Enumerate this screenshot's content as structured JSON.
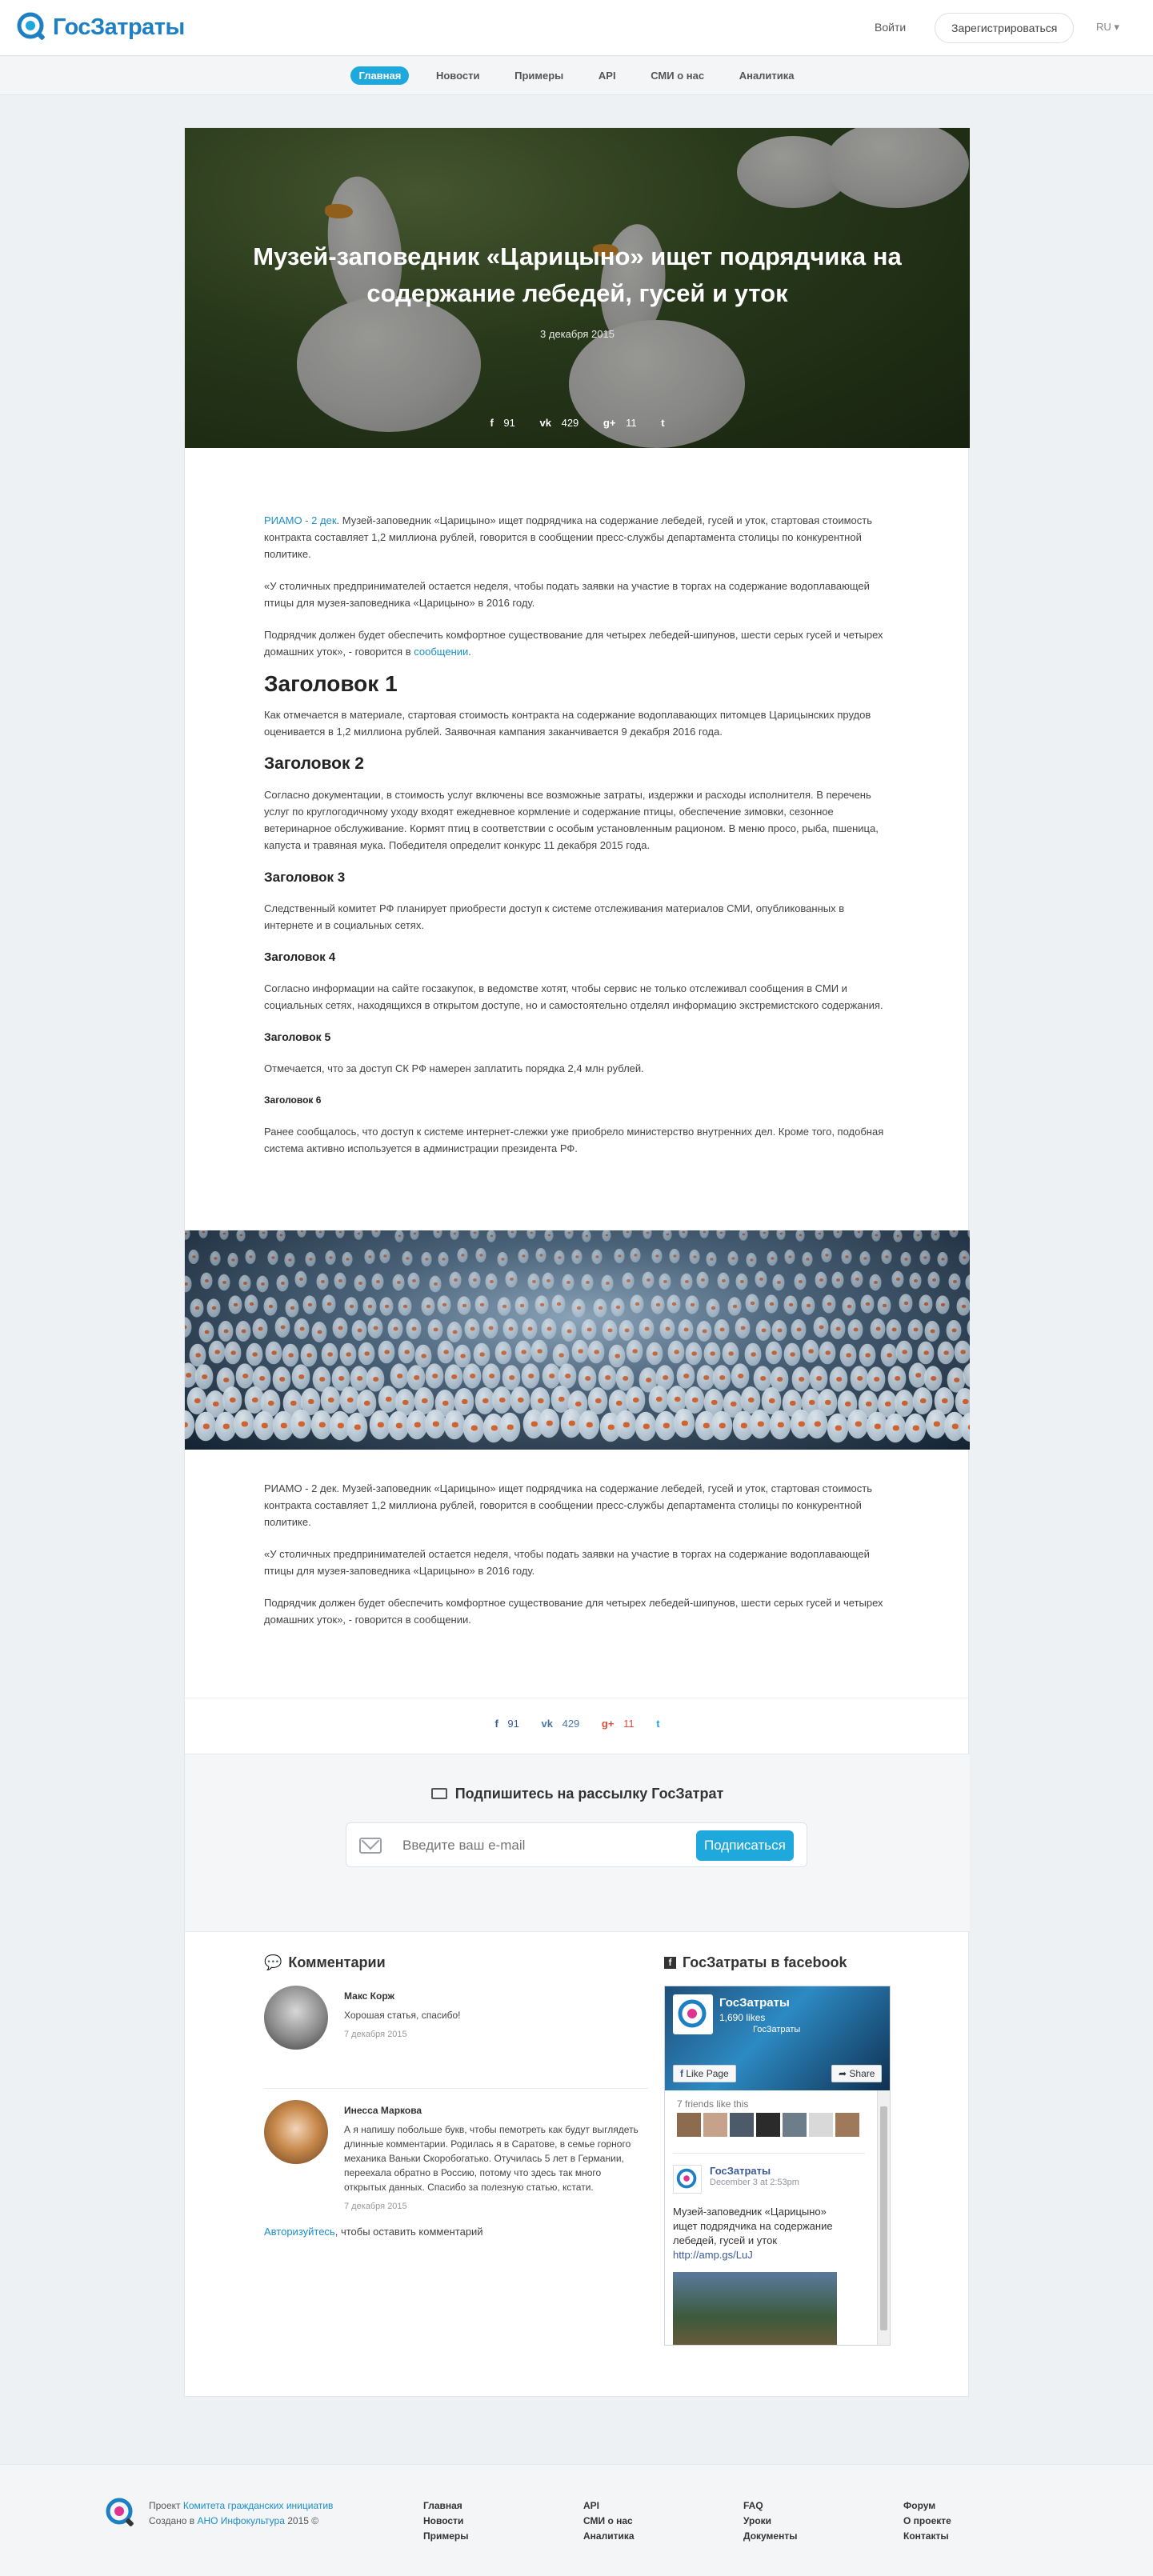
{
  "header": {
    "logo_text": "ГосЗатраты",
    "login_label": "Войти",
    "register_label": "Зарегистрироваться",
    "lang_label": "RU ▾"
  },
  "nav": {
    "items": [
      {
        "label": "Главная"
      },
      {
        "label": "Новости"
      },
      {
        "label": "Примеры"
      },
      {
        "label": "API"
      },
      {
        "label": "СМИ о нас"
      },
      {
        "label": "Аналитика"
      }
    ]
  },
  "article": {
    "title": "Музей-заповедник «Царицыно» ищет подрядчика на содержание лебедей, гусей и уток",
    "date": "3 декабря 2015",
    "share": {
      "fb": "91",
      "vk": "429",
      "gplus": "11"
    },
    "lead_link": "РИАМО - 2 дек",
    "lead_text": ". Музей-заповедник «Царицыно» ищет подрядчика на содержание лебедей, гусей и уток, стартовая стоимость контракта составляет 1,2 миллиона рублей, говорится в сообщении пресс-службы департамента столицы по конкурентной политике.",
    "p2": "«У столичных предпринимателей остается неделя, чтобы подать заявки на участие в торгах на содержание водоплавающей птицы для музея-заповедника «Царицыно» в 2016 году.",
    "p3_text": "Подрядчик должен будет обеспечить комфортное существование для четырех лебедей-шипунов, шести серых гусей и четырех домашних уток», - говорится в ",
    "p3_link": "сообщении",
    "p3_end": ".",
    "h1": "Заголовок 1",
    "h1_text": "Как отмечается в материале, стартовая стоимость контракта на содержание водоплавающих питомцев Царицынских прудов оценивается в 1,2 миллиона рублей. Заявочная кампания заканчивается 9 декабря 2016 года.",
    "h2": "Заголовок 2",
    "h2_text": "Согласно документации, в стоимость услуг включены все возможные затраты, издержки и расходы исполнителя. В перечень услуг по круглогодичному уходу входят ежедневное кормление и содержание птицы, обеспечение зимовки, сезонное ветеринарное обслуживание. Кормят птиц в соответствии с особым установленным рационом. В меню просо, рыба, пшеница, капуста и травяная мука. Победителя определит конкурс 11 декабря 2015 года.",
    "h3": "Заголовок 3",
    "h3_text": "Следственный комитет РФ планирует приобрести доступ к системе отслеживания материалов СМИ, опубликованных в интернете и в социальных сетях.",
    "h4": "Заголовок 4",
    "h4_text": "Согласно информации на сайте госзакупок, в ведомстве хотят, чтобы сервис не только отслеживал сообщения в СМИ и социальных сетях, находящихся в открытом доступе, но и самостоятельно отделял информацию экстремистского содержания.",
    "h5": "Заголовок 5",
    "h5_text": "Отмечается, что за доступ СК РФ намерен заплатить порядка 2,4 млн рублей.",
    "h6": "Заголовок 6",
    "h6_text": "Ранее сообщалось, что доступ к системе интернет-слежки уже приобрело министерство внутренних дел. Кроме того, подобная система активно используется в администрации президента РФ.",
    "after_p1": "РИАМО - 2 дек. Музей-заповедник «Царицыно» ищет подрядчика на содержание лебедей, гусей и уток, стартовая стоимость контракта составляет 1,2 миллиона рублей, говорится в сообщении пресс-службы департамента столицы по конкурентной политике.",
    "after_p2": "«У столичных предпринимателей остается неделя, чтобы подать заявки на участие в торгах на содержание водоплавающей птицы для музея-заповедника «Царицыно» в 2016 году.",
    "after_p3": "Подрядчик должен будет обеспечить комфортное существование для четырех лебедей-шипунов, шести серых гусей и четырех домашних уток», - говорится в сообщении."
  },
  "subscribe": {
    "title": "Подпишитесь на рассылку ГосЗатрат",
    "placeholder": "Введите ваш e-mail",
    "button": "Подписаться"
  },
  "comments": {
    "title": "Комментарии",
    "items": [
      {
        "author": "Макс Корж",
        "text": "Хорошая статья, спасибо!",
        "date": "7 декабря 2015"
      },
      {
        "author": "Инесса Маркова",
        "text": "А я напишу побольше букв, чтобы пемотреть как будут выглядеть длинные комментарии. Родилась я в Саратове, в семье горного механика Ваньки Скоробогатько. Отучилась 5 лет в Германии, переехала обратно в Россию, потому что здесь так много открытых данных. Спасибо за полезную статью, кстати.",
        "date": "7 декабря 2015"
      }
    ],
    "auth_link": "Авторизуйтесь",
    "auth_text": ", чтобы оставить комментарий"
  },
  "facebook": {
    "title": "ГосЗатраты в facebook",
    "page_name": "ГосЗатраты",
    "likes": "1,690 likes",
    "sub": "ГосЗатраты",
    "like_btn": "Like Page",
    "share_btn": "Share",
    "friends": "7 friends like this",
    "post_name": "ГосЗатраты",
    "post_date": "December 3 at 2:53pm",
    "post_text": "Музей-заповедник «Царицыно» ищет подрядчика на содержание лебедей, гусей и уток ",
    "post_link": "http://amp.gs/LuJ"
  },
  "footer": {
    "about_prefix": "Проект ",
    "about_link1": "Комитета гражданских инициатив",
    "about_mid": "Создано в ",
    "about_link2": "АНО Инфокультура",
    "about_suffix": " 2015 ©",
    "col1": [
      "Главная",
      "Новости",
      "Примеры"
    ],
    "col2": [
      "API",
      "СМИ о нас",
      "Аналитика"
    ],
    "col3": [
      "FAQ",
      "Уроки",
      "Документы"
    ],
    "col4": [
      "Форум",
      "О проекте",
      "Контакты"
    ]
  },
  "colors": {
    "accent": "#1fa8dc",
    "brand": "#1d7fc4",
    "link": "#1b8ec9"
  }
}
